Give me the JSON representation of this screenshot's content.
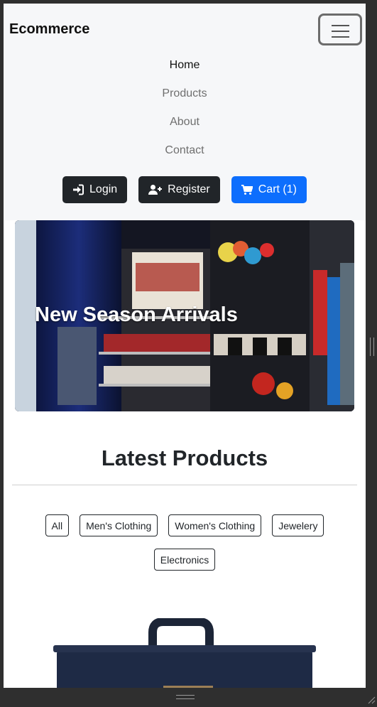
{
  "navbar": {
    "brand": "Ecommerce",
    "links": [
      {
        "label": "Home",
        "active": true
      },
      {
        "label": "Products",
        "active": false
      },
      {
        "label": "About",
        "active": false
      },
      {
        "label": "Contact",
        "active": false
      }
    ],
    "buttons": {
      "login": "Login",
      "register": "Register",
      "cart": "Cart (1)"
    },
    "icons": {
      "toggler": "hamburger-icon",
      "login": "sign-in-icon",
      "register": "user-plus-icon",
      "cart": "shopping-cart-icon"
    }
  },
  "hero": {
    "title": "New Season Arrivals"
  },
  "products": {
    "title": "Latest Products",
    "filters": [
      "All",
      "Men's Clothing",
      "Women's Clothing",
      "Jewelery",
      "Electronics"
    ]
  },
  "colors": {
    "navbar_bg": "#f6f7f9",
    "dark_button": "#212529",
    "primary_button": "#0d6efd"
  }
}
